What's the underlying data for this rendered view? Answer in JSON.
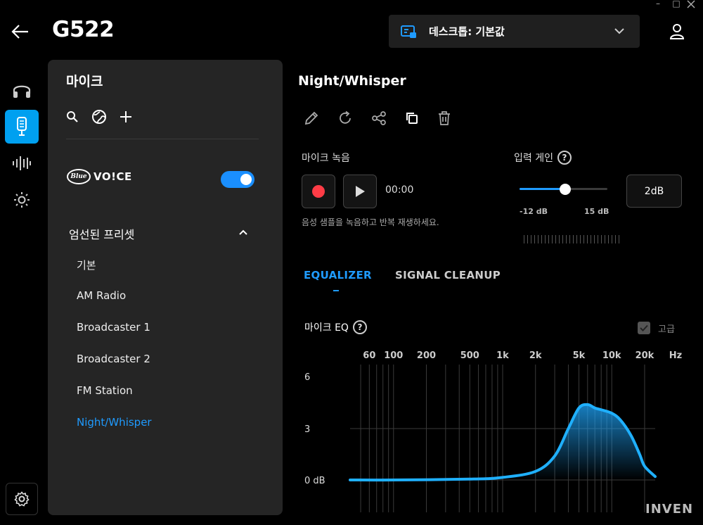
{
  "window": {
    "minimize": "–",
    "maximize": "□"
  },
  "header": {
    "title": "G522",
    "profile_label": "데스크톱: 기본값"
  },
  "panel": {
    "title": "마이크",
    "blue_logo_word": "Blue",
    "voice_brand": "VO!CE",
    "blue_voice_enabled": true,
    "section_title": "엄선된 프리셋",
    "presets": [
      "기본",
      "AM Radio",
      "Broadcaster 1",
      "Broadcaster 2",
      "FM Station",
      "Night/Whisper"
    ],
    "selected_preset_index": 5
  },
  "main": {
    "preset_title": "Night/Whisper",
    "recording": {
      "label": "마이크 녹음",
      "time": "00:00",
      "hint": "음성 샘플을 녹음하고 반복 재생하세요."
    },
    "gain": {
      "label": "입력 게인",
      "help": "?",
      "min_label": "-12 dB",
      "max_label": "15 dB",
      "value_label": "2dB",
      "value_db": 2,
      "min_db": -12,
      "max_db": 15
    },
    "tabs": [
      {
        "label": "EQUALIZER",
        "active": true
      },
      {
        "label": "SIGNAL CLEANUP",
        "active": false
      }
    ],
    "eq": {
      "label": "마이크 EQ",
      "help": "?",
      "advanced_label": "고급",
      "advanced_checked": true
    }
  },
  "chart_data": {
    "type": "line",
    "x_ticks": [
      "60",
      "100",
      "200",
      "500",
      "1k",
      "2k",
      "5k",
      "10k",
      "20k"
    ],
    "x_unit": "Hz",
    "y_ticks": [
      "6",
      "3",
      "0 dB"
    ],
    "ylim": [
      0,
      6
    ],
    "x_scale": "log",
    "series": [
      {
        "x": [
          40,
          100,
          500,
          1000,
          2000,
          3000,
          4000,
          5000,
          6000,
          7000,
          8000,
          10000,
          12000,
          15000,
          18000,
          20000,
          25000
        ],
        "y": [
          0,
          0,
          0.05,
          0.15,
          0.5,
          1.4,
          3.0,
          4.2,
          4.4,
          4.2,
          4.1,
          3.9,
          3.5,
          2.6,
          1.5,
          0.8,
          0.2
        ]
      }
    ],
    "grid": true
  },
  "watermark": "INVEN",
  "colors": {
    "accent": "#1f9bff",
    "record": "#ff3c46",
    "panel": "#252525"
  }
}
